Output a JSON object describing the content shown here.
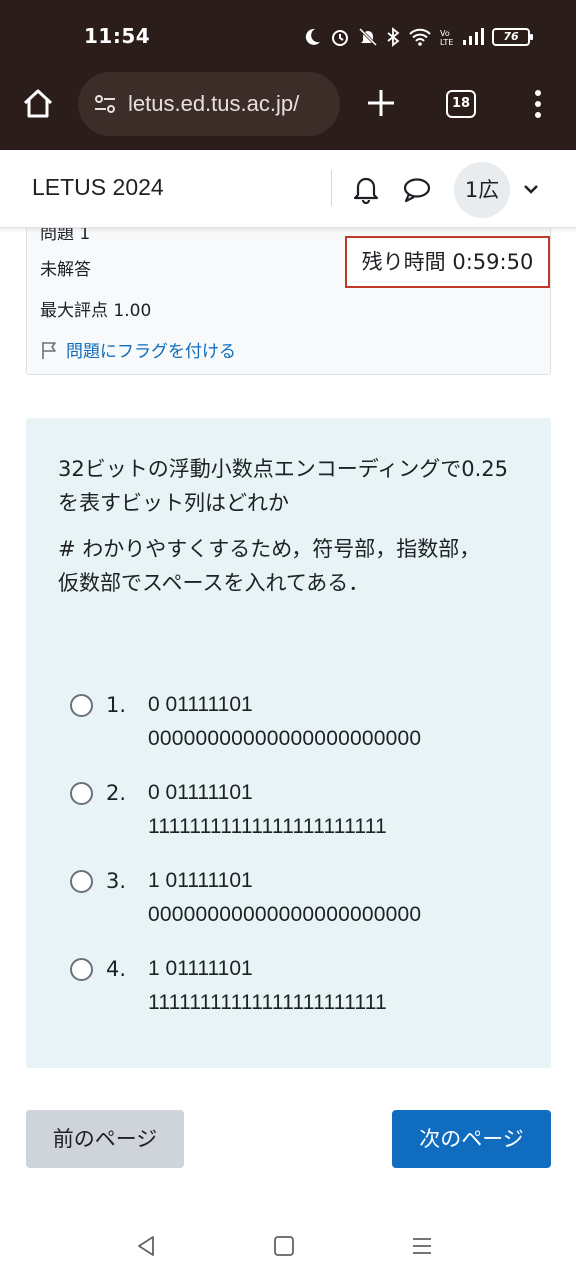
{
  "status_bar": {
    "time": "11:54",
    "battery": "76",
    "icons": [
      "moon-icon",
      "alarm-icon",
      "bell-off-icon",
      "bluetooth-icon",
      "wifi-icon",
      "volte-icon",
      "signal-icon",
      "battery-icon"
    ]
  },
  "browser": {
    "url": "letus.ed.tus.ac.jp/",
    "tab_count": "18",
    "icons": [
      "home-icon",
      "site-settings-icon",
      "plus-icon",
      "tabs-icon",
      "more-vert-icon"
    ]
  },
  "header": {
    "site_title": "LETUS 2024",
    "avatar_initials": "1広",
    "icons": [
      "bell-icon",
      "chat-icon",
      "chevron-down-icon"
    ]
  },
  "question_info": {
    "question_label": "問題 1",
    "state": "未解答",
    "max_grade": "最大評点 1.00",
    "flag_label": "問題にフラグを付ける",
    "timer": "残り時間 0:59:50"
  },
  "question": {
    "text": "32ビットの浮動小数点エンコーディングで0.25を表すビット列はどれか",
    "note": "# わかりやすくするため，符号部，指数部，仮数部でスペースを入れてある．",
    "options": [
      {
        "number": "1.",
        "line1": "0 01111101",
        "line2": "00000000000000000000000"
      },
      {
        "number": "2.",
        "line1": "0 01111101",
        "line2": "11111111111111111111111"
      },
      {
        "number": "3.",
        "line1": "1 01111101",
        "line2": "00000000000000000000000"
      },
      {
        "number": "4.",
        "line1": "1 01111101",
        "line2": "11111111111111111111111"
      }
    ]
  },
  "navigation": {
    "prev_label": "前のページ",
    "next_label": "次のページ"
  },
  "colors": {
    "status_bg": "#2b1d1a",
    "question_bg": "#e7f3f5",
    "primary": "#0f6cbf",
    "timer_border": "#c0392b"
  }
}
